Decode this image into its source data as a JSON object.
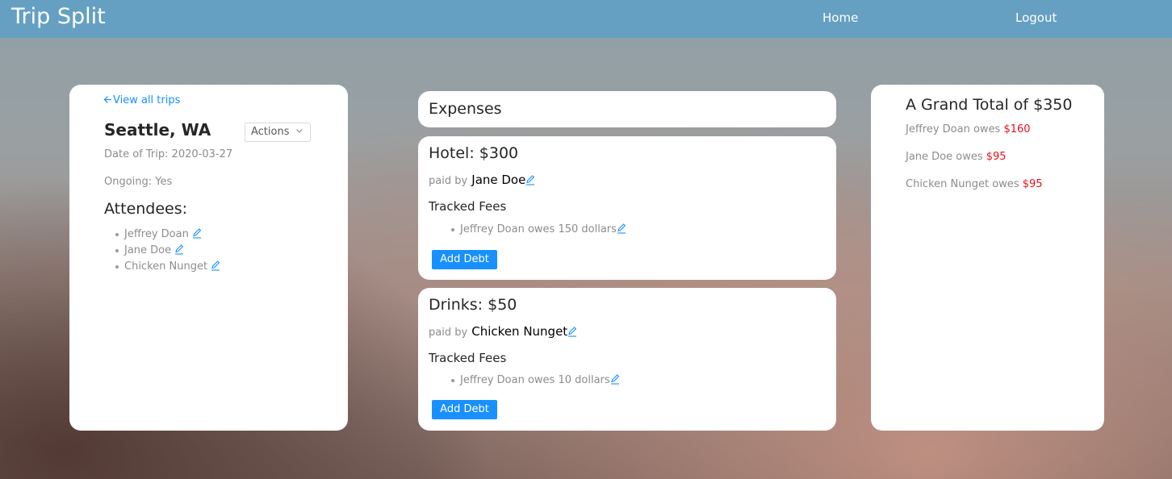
{
  "app": {
    "title": "Trip Split"
  },
  "nav": {
    "home": "Home",
    "logout": "Logout"
  },
  "trip": {
    "back_link": "View all trips",
    "name": "Seattle, WA",
    "actions_label": "Actions",
    "date": "Date of Trip: 2020-03-27",
    "ongoing": "Ongoing: Yes",
    "attendees_heading": "Attendees:",
    "attendees": [
      "Jeffrey Doan",
      "Jane Doe",
      "Chicken Nunget"
    ]
  },
  "expenses": {
    "heading": "Expenses",
    "items": [
      {
        "title": "Hotel: $300",
        "paid_by_label": "paid by",
        "payer": "Jane Doe",
        "fees_heading": "Tracked Fees",
        "fees": [
          "Jeffrey Doan owes 150 dollars"
        ],
        "add_debt_label": "Add Debt"
      },
      {
        "title": "Drinks: $50",
        "paid_by_label": "paid by",
        "payer": "Chicken Nunget",
        "fees_heading": "Tracked Fees",
        "fees": [
          "Jeffrey Doan owes 10 dollars"
        ],
        "add_debt_label": "Add Debt"
      }
    ]
  },
  "summary": {
    "heading": "A Grand Total of $350",
    "rows": [
      {
        "text": "Jeffrey Doan owes",
        "amount": "$160"
      },
      {
        "text": "Jane Doe owes",
        "amount": "$95"
      },
      {
        "text": "Chicken Nunget owes",
        "amount": "$95"
      }
    ]
  },
  "colors": {
    "navbar": "#65a0c3",
    "accent": "#1890ff",
    "owed": "#e8101a"
  }
}
